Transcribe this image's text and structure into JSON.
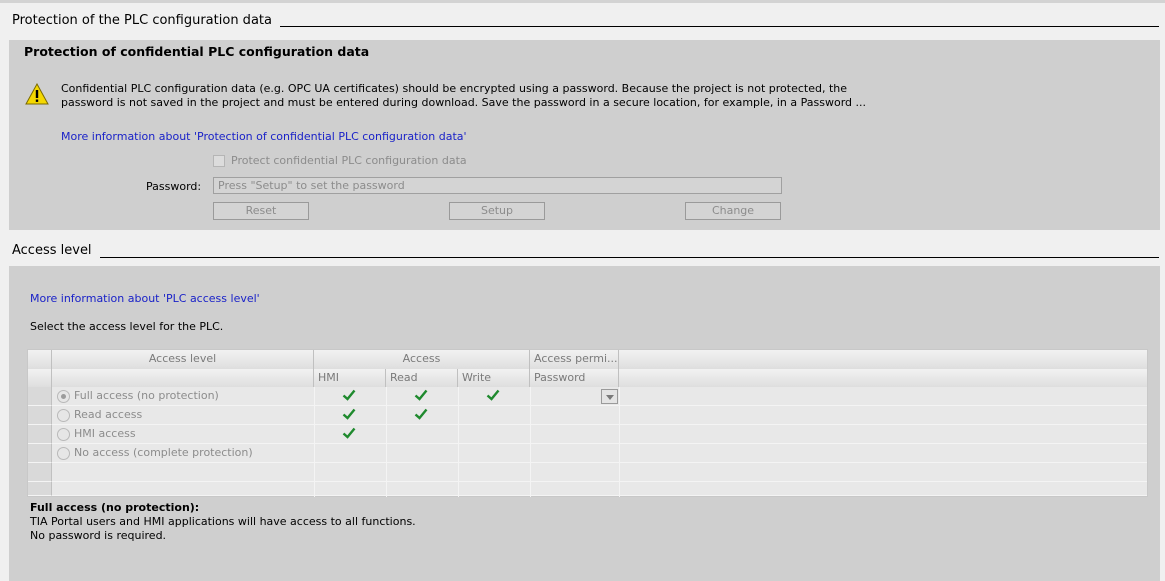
{
  "sections": {
    "protection_title": "Protection of the PLC configuration data",
    "access_title": "Access level"
  },
  "confidential": {
    "title": "Protection of confidential PLC configuration data",
    "warning_line1": "Confidential PLC configuration data (e.g. OPC UA certificates) should be encrypted using a password. Because the project is not protected, the",
    "warning_line2": "password is not saved in the project and must be entered during download. Save the password in a secure location, for example, in a Password ...",
    "more_info": "More information about 'Protection of confidential PLC configuration data'",
    "checkbox_label": "Protect confidential PLC configuration data",
    "password_label": "Password:",
    "password_placeholder": "Press \"Setup\" to set the password",
    "buttons": {
      "reset": "Reset",
      "setup": "Setup",
      "change": "Change"
    }
  },
  "access": {
    "more_info": "More information about 'PLC access level'",
    "instruction": "Select the access level for the PLC.",
    "headers": {
      "access_level": "Access level",
      "access": "Access",
      "access_permission": "Access permi...",
      "hmi": "HMI",
      "read": "Read",
      "write": "Write",
      "password": "Password"
    },
    "rows": [
      {
        "label": "Full access (no protection)",
        "selected": true,
        "hmi": true,
        "read": true,
        "write": true
      },
      {
        "label": "Read access",
        "selected": false,
        "hmi": true,
        "read": true,
        "write": false
      },
      {
        "label": "HMI access",
        "selected": false,
        "hmi": true,
        "read": false,
        "write": false
      },
      {
        "label": "No access (complete protection)",
        "selected": false,
        "hmi": false,
        "read": false,
        "write": false
      }
    ],
    "description_title": "Full access (no protection):",
    "description_line1": "TIA Portal users and HMI applications will have access to all functions.",
    "description_line2": "No password is required."
  },
  "colors": {
    "check": "#1f8a2e",
    "link": "#1a22c8",
    "warning": "#f5d800"
  }
}
